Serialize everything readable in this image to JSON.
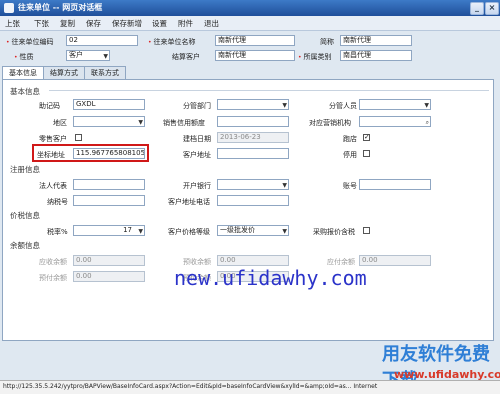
{
  "window": {
    "title": "往来单位 -- 网页对话框"
  },
  "menu": [
    "上张",
    "下张",
    "复制",
    "保存",
    "保存新增",
    "设置",
    "附件",
    "退出"
  ],
  "header": {
    "code_label": "往来单位编码",
    "code_value": "02",
    "name_label": "往来单位名称",
    "name_value": "南新代理",
    "short_label": "简称",
    "short_value": "南新代理",
    "nature_label": "性质",
    "nature_value": "客户",
    "settle_label": "结算客户",
    "settle_value": "南新代理",
    "category_label": "所属类别",
    "category_value": "南昌代理"
  },
  "tabs": [
    "基本信息",
    "结算方式",
    "联系方式"
  ],
  "basic": {
    "section": "基本信息",
    "mnemonic_label": "助记码",
    "mnemonic_value": "GXDL",
    "dept_label": "分管部门",
    "dept_value": "",
    "staff_label": "分管人员",
    "staff_value": "",
    "region_label": "地区",
    "region_value": "",
    "credit_label": "销售信用额度",
    "credit_value": "",
    "org_label": "对应营销机构",
    "org_value": "",
    "retail_label": "零售客户",
    "created_label": "建档日期",
    "created_value": "2013-06-23",
    "store_label": "跑店",
    "coord_label": "坐标地址",
    "coord_value": "115.9677658081054",
    "address_label": "客户地址",
    "address_value": "",
    "disabled_label": "停用"
  },
  "register": {
    "section": "注册信息",
    "legal_label": "法人代表",
    "legal_value": "",
    "bank_label": "开户银行",
    "bank_value": "",
    "account_label": "账号",
    "account_value": "",
    "tax_label": "纳税号",
    "tax_value": "",
    "phone_label": "客户地址电话",
    "phone_value": ""
  },
  "price": {
    "section": "价税信息",
    "rate_label": "税率%",
    "rate_value": "17",
    "level_label": "客户价格等级",
    "level_value": "一级批发价",
    "include_tax_label": "采购报价含税"
  },
  "balance": {
    "section": "余额信息",
    "r1_label": "应收余额",
    "r1_value": "0.00",
    "r2_label": "预收余额",
    "r2_value": "0.00",
    "r3_label": "应付余额",
    "r3_value": "0.00",
    "r4_label": "预付余额",
    "r4_value": "0.00",
    "r5_label": "预付余额",
    "r5_value": "0.00"
  },
  "overlay": {
    "site": "new.ufidawhy.com",
    "brand": "用友软件免费下载",
    "site_small": "www.ufidawhy.com"
  },
  "status": {
    "url": "http://125.35.5.242/yytpro/BAPView/BaseInfoCard.aspx?Action=Edit&pId=baseInfoCardView&xylId=&amp;oId=as...  Internet"
  }
}
